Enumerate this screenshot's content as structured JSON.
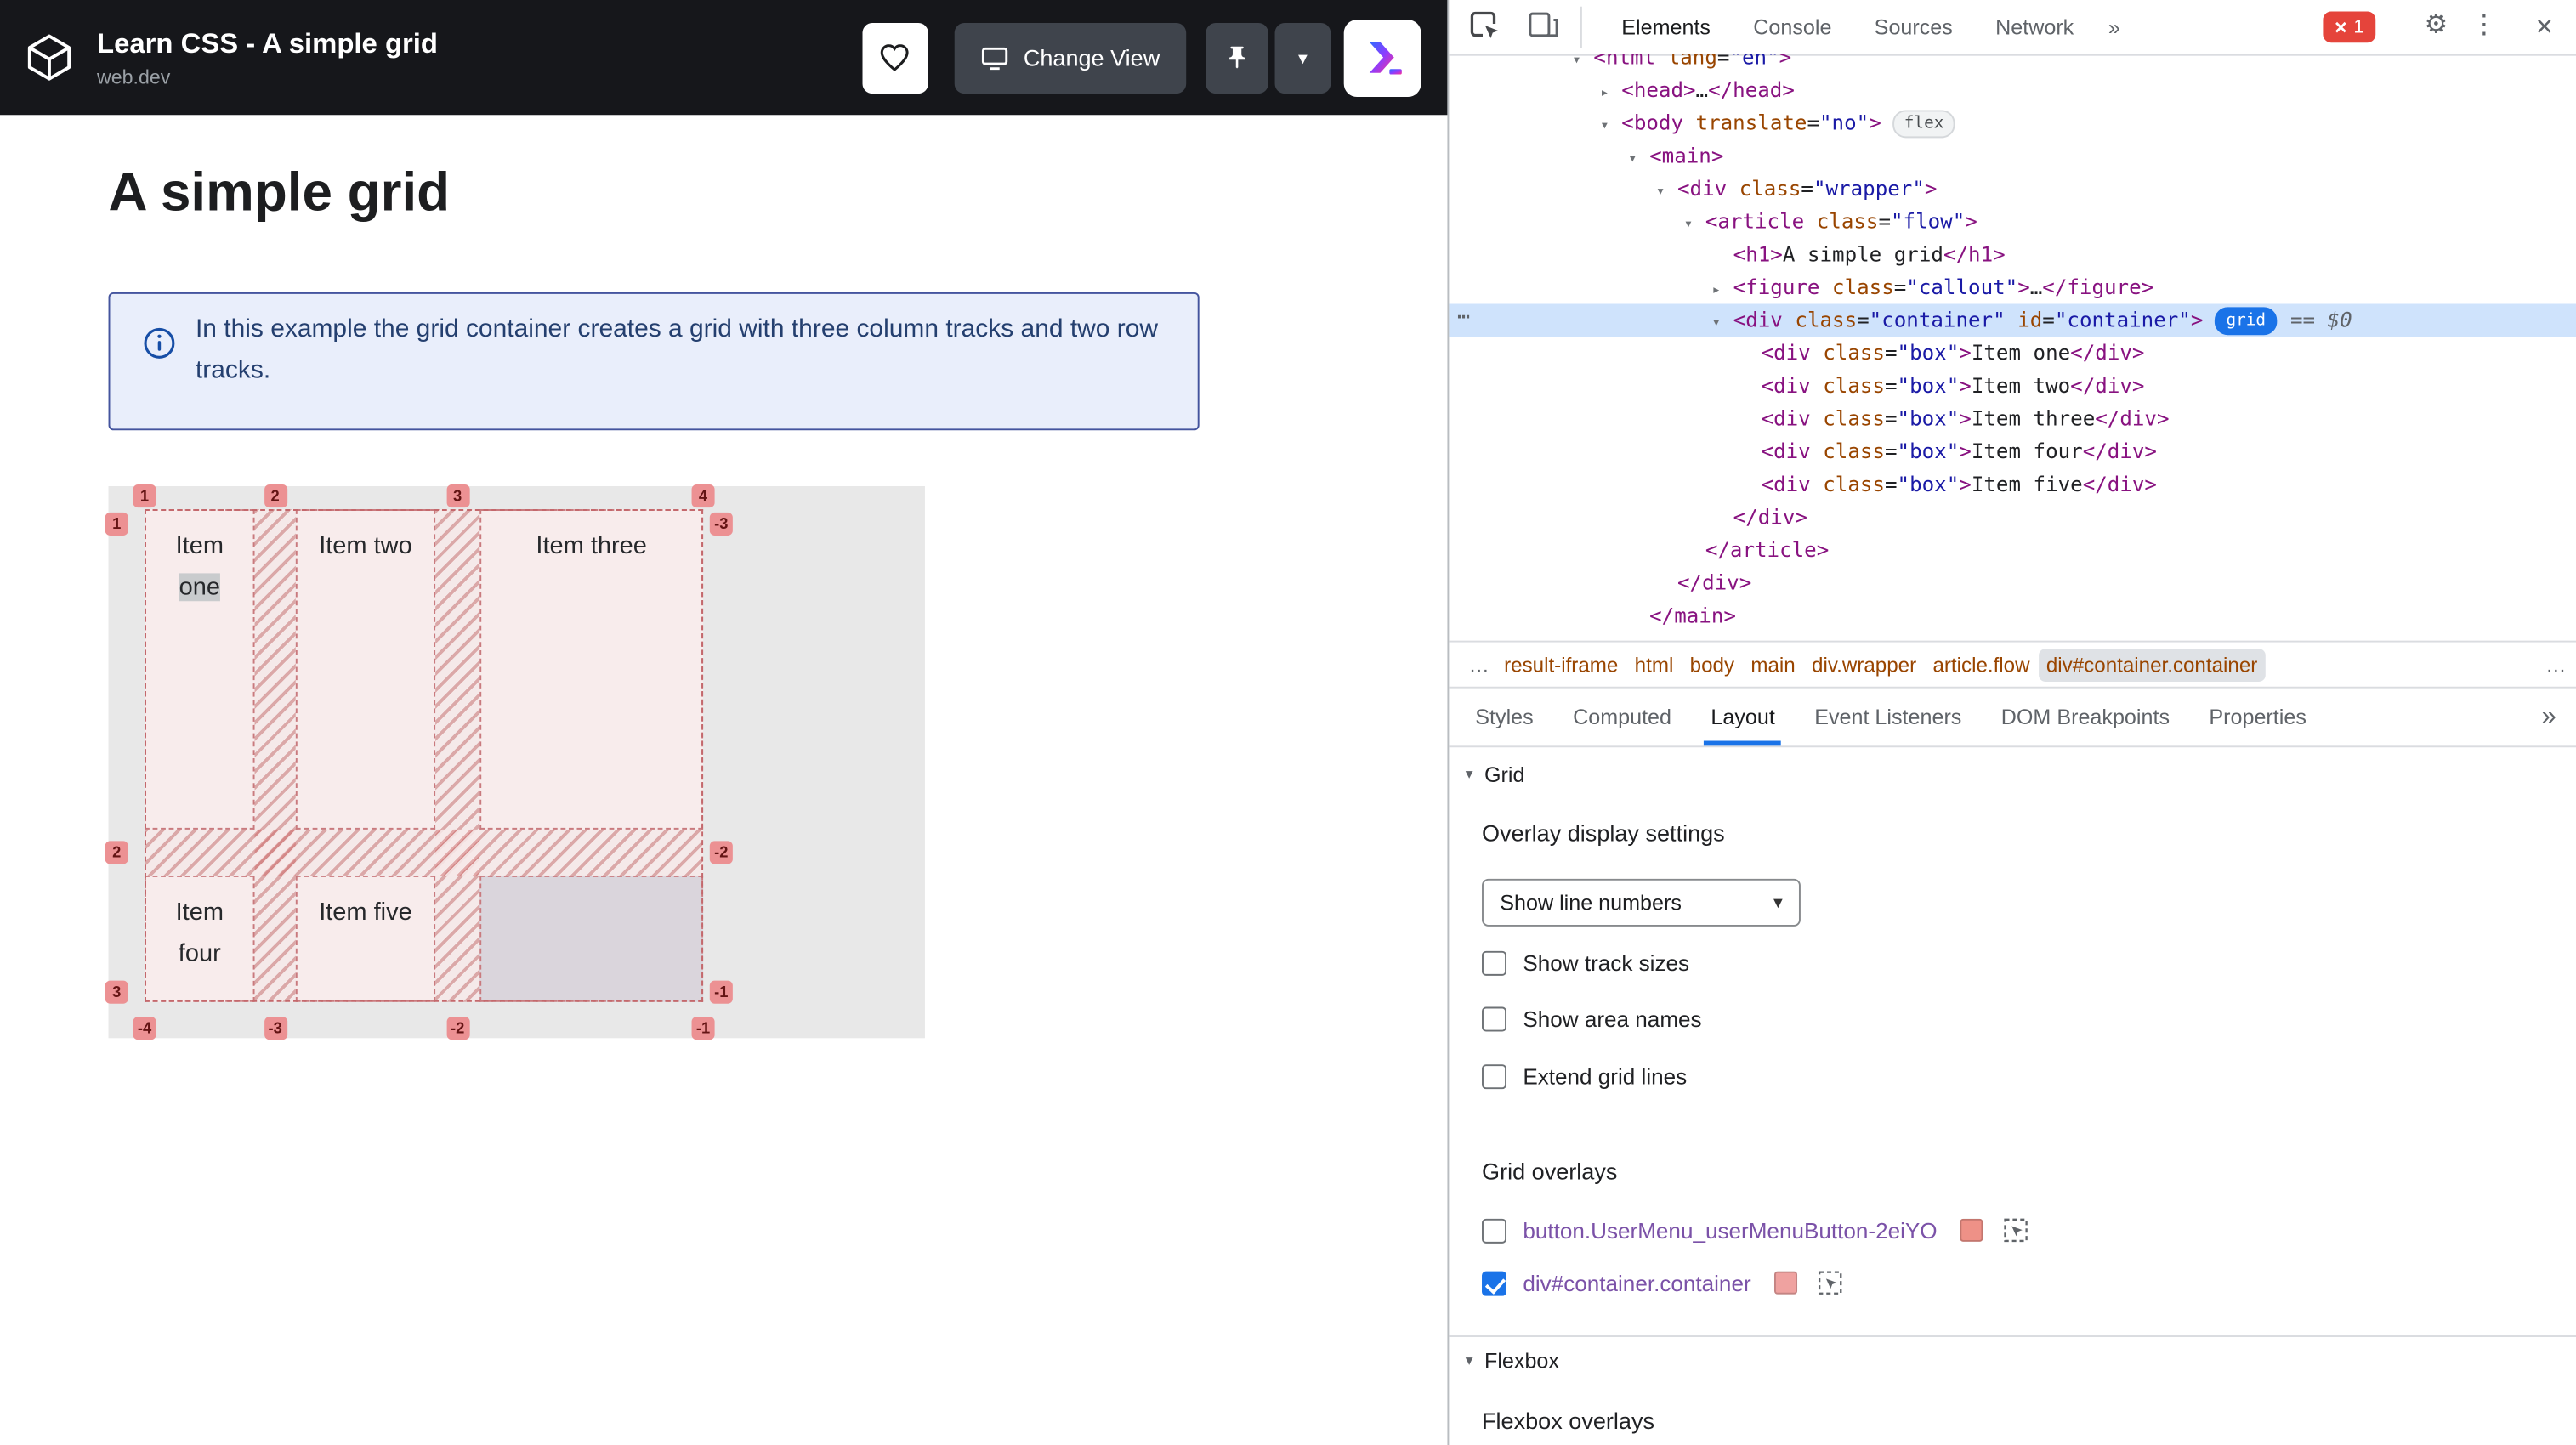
{
  "colors": {
    "accent_blue": "#1a73e8",
    "grid_badge_blue": "#1a73e8",
    "grid_overlay_salmon": "#ec9193",
    "selected_row_blue": "#cfe3fc",
    "header_bg": "#16171b",
    "error_red": "#e5443b"
  },
  "embed": {
    "title": "Learn CSS - A simple grid",
    "site": "web.dev",
    "change_view_label": "Change View"
  },
  "article": {
    "heading": "A simple grid",
    "callout_text": "In this example the grid container creates a grid with three column tracks and two row tracks."
  },
  "grid_demo": {
    "items": [
      {
        "label": "Item one",
        "highlight": "one"
      },
      {
        "label": "Item two"
      },
      {
        "label": "Item three"
      },
      {
        "label": "Item four"
      },
      {
        "label": "Item five"
      }
    ],
    "line_numbers": {
      "top": [
        "1",
        "2",
        "3",
        "4"
      ],
      "bottom": [
        "-4",
        "-3",
        "-2",
        "-1"
      ],
      "left": [
        "1",
        "2",
        "3"
      ],
      "right": [
        "-3",
        "-2",
        "-1"
      ]
    }
  },
  "devtools": {
    "toolbar": {
      "tabs": [
        "Elements",
        "Console",
        "Sources",
        "Network"
      ],
      "more_label": "»",
      "error_count": "1",
      "error_x": "×",
      "gear": "⚙",
      "kebab": "⋮",
      "close": "×"
    },
    "tree": [
      {
        "level": 0,
        "arrow": "open",
        "tokens": [
          [
            "tag",
            "<html"
          ],
          [
            "attr",
            " lang"
          ],
          [
            "eq",
            "="
          ],
          [
            "val",
            "\"en\""
          ],
          [
            "tag",
            ">"
          ]
        ]
      },
      {
        "level": 1,
        "arrow": "closed",
        "tokens": [
          [
            "tag",
            "<head>"
          ],
          [
            "txt",
            "…"
          ],
          [
            "tag",
            "</head>"
          ]
        ]
      },
      {
        "level": 1,
        "arrow": "open",
        "badge": "flex",
        "tokens": [
          [
            "tag",
            "<body"
          ],
          [
            "attr",
            " translate"
          ],
          [
            "eq",
            "="
          ],
          [
            "val",
            "\"no\""
          ],
          [
            "tag",
            ">"
          ]
        ]
      },
      {
        "level": 2,
        "arrow": "open",
        "tokens": [
          [
            "tag",
            "<main>"
          ]
        ]
      },
      {
        "level": 3,
        "arrow": "open",
        "tokens": [
          [
            "tag",
            "<div"
          ],
          [
            "attr",
            " class"
          ],
          [
            "eq",
            "="
          ],
          [
            "val",
            "\"wrapper\""
          ],
          [
            "tag",
            ">"
          ]
        ]
      },
      {
        "level": 4,
        "arrow": "open",
        "tokens": [
          [
            "tag",
            "<article"
          ],
          [
            "attr",
            " class"
          ],
          [
            "eq",
            "="
          ],
          [
            "val",
            "\"flow\""
          ],
          [
            "tag",
            ">"
          ]
        ]
      },
      {
        "level": 5,
        "tokens": [
          [
            "tag",
            "<h1>"
          ],
          [
            "txt",
            "A simple grid"
          ],
          [
            "tag",
            "</h1>"
          ]
        ]
      },
      {
        "level": 5,
        "arrow": "closed",
        "tokens": [
          [
            "tag",
            "<figure"
          ],
          [
            "attr",
            " class"
          ],
          [
            "eq",
            "="
          ],
          [
            "val",
            "\"callout\""
          ],
          [
            "tag",
            ">"
          ],
          [
            "txt",
            "…"
          ],
          [
            "tag",
            "</figure>"
          ]
        ]
      },
      {
        "level": 5,
        "arrow": "open",
        "selected": true,
        "badge_active": "grid",
        "suffix": "== $0",
        "tokens": [
          [
            "tag",
            "<div"
          ],
          [
            "attr",
            " class"
          ],
          [
            "eq",
            "="
          ],
          [
            "val",
            "\"container\""
          ],
          [
            "attr",
            " id"
          ],
          [
            "eq",
            "="
          ],
          [
            "val",
            "\"container\""
          ],
          [
            "tag",
            ">"
          ]
        ]
      },
      {
        "level": 6,
        "tokens": [
          [
            "tag",
            "<div"
          ],
          [
            "attr",
            " class"
          ],
          [
            "eq",
            "="
          ],
          [
            "val",
            "\"box\""
          ],
          [
            "tag",
            ">"
          ],
          [
            "txt",
            "Item one"
          ],
          [
            "tag",
            "</div>"
          ]
        ]
      },
      {
        "level": 6,
        "tokens": [
          [
            "tag",
            "<div"
          ],
          [
            "attr",
            " class"
          ],
          [
            "eq",
            "="
          ],
          [
            "val",
            "\"box\""
          ],
          [
            "tag",
            ">"
          ],
          [
            "txt",
            "Item two"
          ],
          [
            "tag",
            "</div>"
          ]
        ]
      },
      {
        "level": 6,
        "tokens": [
          [
            "tag",
            "<div"
          ],
          [
            "attr",
            " class"
          ],
          [
            "eq",
            "="
          ],
          [
            "val",
            "\"box\""
          ],
          [
            "tag",
            ">"
          ],
          [
            "txt",
            "Item three"
          ],
          [
            "tag",
            "</div>"
          ]
        ]
      },
      {
        "level": 6,
        "tokens": [
          [
            "tag",
            "<div"
          ],
          [
            "attr",
            " class"
          ],
          [
            "eq",
            "="
          ],
          [
            "val",
            "\"box\""
          ],
          [
            "tag",
            ">"
          ],
          [
            "txt",
            "Item four"
          ],
          [
            "tag",
            "</div>"
          ]
        ]
      },
      {
        "level": 6,
        "tokens": [
          [
            "tag",
            "<div"
          ],
          [
            "attr",
            " class"
          ],
          [
            "eq",
            "="
          ],
          [
            "val",
            "\"box\""
          ],
          [
            "tag",
            ">"
          ],
          [
            "txt",
            "Item five"
          ],
          [
            "tag",
            "</div>"
          ]
        ]
      },
      {
        "level": 5,
        "tokens": [
          [
            "tag",
            "</div>"
          ]
        ]
      },
      {
        "level": 4,
        "tokens": [
          [
            "tag",
            "</article>"
          ]
        ]
      },
      {
        "level": 3,
        "tokens": [
          [
            "tag",
            "</div>"
          ]
        ]
      },
      {
        "level": 2,
        "tokens": [
          [
            "tag",
            "</main>"
          ]
        ]
      }
    ],
    "breadcrumbs": {
      "overflow_left": "…",
      "items": [
        "result-iframe",
        "html",
        "body",
        "main",
        "div.wrapper",
        "article.flow",
        "div#container.container"
      ],
      "active": "div#container.container",
      "overflow_right": "…"
    },
    "sidebar_tabs": {
      "items": [
        "Styles",
        "Computed",
        "Layout",
        "Event Listeners",
        "DOM Breakpoints",
        "Properties"
      ],
      "active": "Layout",
      "more_label": "»"
    },
    "layout_pane": {
      "grid_section_label": "Grid",
      "overlay_settings_title": "Overlay display settings",
      "line_numbers_dropdown": "Show line numbers",
      "display_options": [
        {
          "label": "Show track sizes",
          "checked": false
        },
        {
          "label": "Show area names",
          "checked": false
        },
        {
          "label": "Extend grid lines",
          "checked": false
        }
      ],
      "grid_overlays_title": "Grid overlays",
      "overlays": [
        {
          "label": "button.UserMenu_userMenuButton-2eiYO",
          "checked": false,
          "swatch": "#ee9187"
        },
        {
          "label": "div#container.container",
          "checked": true,
          "swatch": "#efa2a0"
        }
      ],
      "flexbox_section_label": "Flexbox",
      "flexbox_overlays_title": "Flexbox overlays"
    }
  }
}
